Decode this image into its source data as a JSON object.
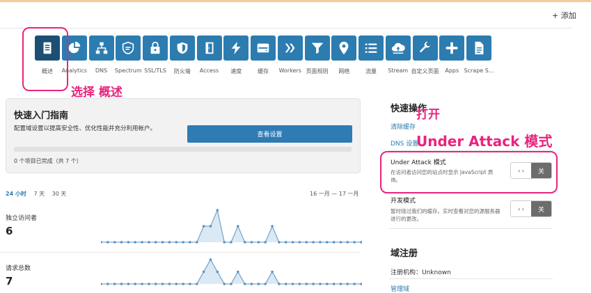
{
  "header": {
    "add_label": "+ 添加"
  },
  "nav": [
    {
      "label": "概述",
      "icon": "document-icon"
    },
    {
      "label": "Analytics",
      "icon": "pie-chart-icon"
    },
    {
      "label": "DNS",
      "icon": "network-icon"
    },
    {
      "label": "Spectrum",
      "icon": "shield-lines-icon"
    },
    {
      "label": "SSL/TLS",
      "icon": "lock-icon"
    },
    {
      "label": "防火墙",
      "icon": "shield-icon"
    },
    {
      "label": "Access",
      "icon": "door-icon"
    },
    {
      "label": "速度",
      "icon": "lightning-icon"
    },
    {
      "label": "缓存",
      "icon": "drive-icon"
    },
    {
      "label": "Workers",
      "icon": "workers-icon"
    },
    {
      "label": "页面规则",
      "icon": "filter-icon"
    },
    {
      "label": "网络",
      "icon": "map-pin-icon"
    },
    {
      "label": "流量",
      "icon": "list-icon"
    },
    {
      "label": "Stream",
      "icon": "cloud-upload-icon"
    },
    {
      "label": "自定义页面",
      "icon": "wrench-icon"
    },
    {
      "label": "Apps",
      "icon": "plus-icon"
    },
    {
      "label": "Scrape S...",
      "icon": "file-icon"
    }
  ],
  "annotations": {
    "select_overview": "选择 概述",
    "open": "打开",
    "under_attack": "Under Attack 模式"
  },
  "quick_start": {
    "title": "快速入门指南",
    "description": "配置域设置以提高安全性、优化性能并充分利用帐户。",
    "button": "查看设置",
    "progress_text": "0 个项目已完成（共 7 个）",
    "progress_fraction": 0
  },
  "time_ranges": [
    "24 小时",
    "7 天",
    "30 天"
  ],
  "date_range": "16 一月 — 17 一月",
  "stats": [
    {
      "label": "独立访问者",
      "value": "6",
      "series": [
        0,
        0,
        0,
        0,
        0,
        0,
        0,
        0,
        0,
        0,
        0,
        0,
        0,
        0,
        0,
        1,
        1,
        2,
        0,
        0,
        1,
        0,
        0,
        0,
        0,
        1,
        0,
        0,
        0,
        0,
        0,
        0,
        0,
        0,
        0,
        0,
        0,
        0,
        0
      ]
    },
    {
      "label": "请求总数",
      "value": "7",
      "series": [
        0,
        0,
        0,
        0,
        0,
        0,
        0,
        0,
        0,
        0,
        0,
        0,
        0,
        0,
        0,
        1,
        2,
        1,
        0,
        0,
        1,
        0,
        0,
        0,
        0,
        1,
        0,
        0,
        0,
        0,
        0,
        0,
        0,
        0,
        0,
        0,
        0,
        0,
        0
      ]
    }
  ],
  "quick_actions": {
    "title": "快速操作",
    "purge_cache": "清除缓存",
    "dns_settings": "DNS 设置",
    "under_attack": {
      "title": "Under Attack 模式",
      "desc": "在访问者访问您的站点时显示 JavaScript 质询。",
      "arrows": "‹ ›",
      "state": "关"
    },
    "dev_mode": {
      "title": "开发模式",
      "desc": "暂时绕过我们的缓存。实时查看对您的源服务器进行的更改。",
      "arrows": "‹ ›",
      "state": "关"
    }
  },
  "domain_registration": {
    "title": "域注册",
    "registrar": "注册机构：Unknown",
    "manage": "管理域"
  }
}
